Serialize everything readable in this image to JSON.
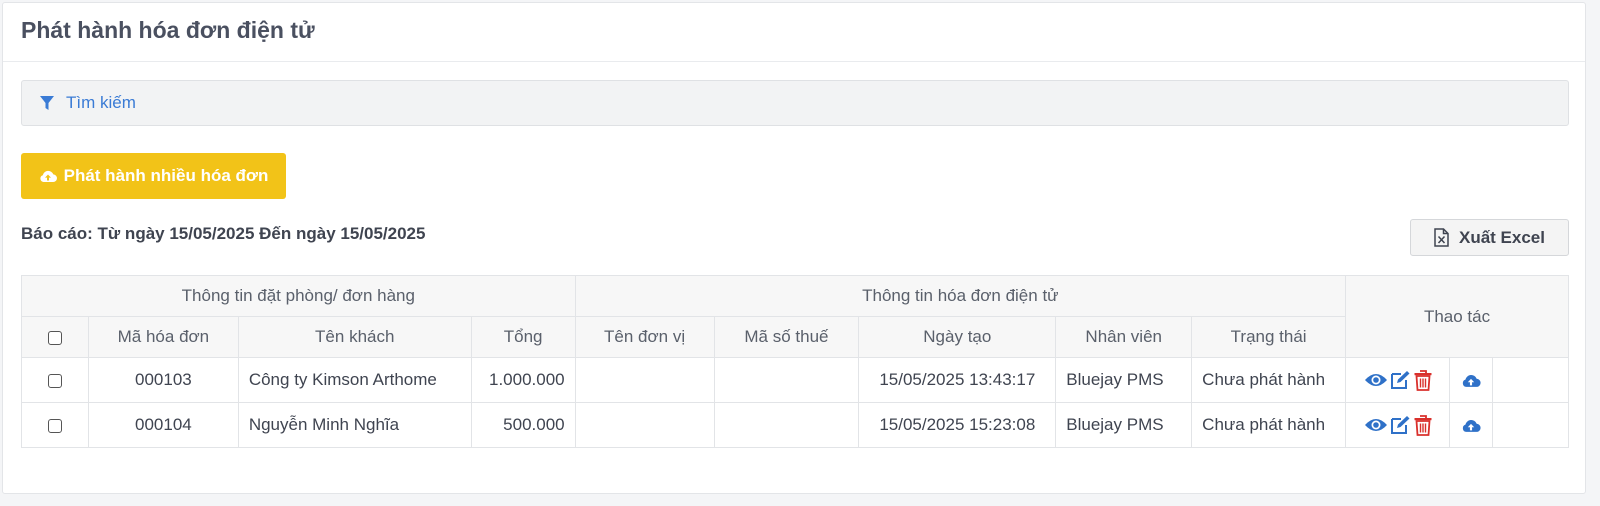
{
  "page": {
    "title": "Phát hành hóa đơn điện tử"
  },
  "search": {
    "label": "Tìm kiếm"
  },
  "actions": {
    "publish_many": "Phát hành nhiều hóa đơn",
    "export_excel": "Xuất Excel"
  },
  "report": {
    "range": "Báo cáo: Từ ngày 15/05/2025 Đến ngày 15/05/2025"
  },
  "table": {
    "group_headers": {
      "booking": "Thông tin đặt phòng/ đơn hàng",
      "einvoice": "Thông tin hóa đơn điện tử",
      "actions": "Thao tác"
    },
    "columns": {
      "invoice_code": "Mã hóa đơn",
      "customer": "Tên khách",
      "total": "Tổng",
      "unit_name": "Tên đơn vị",
      "tax_code": "Mã số thuế",
      "created": "Ngày tạo",
      "staff": "Nhân viên",
      "status": "Trạng thái"
    },
    "rows": [
      {
        "invoice_code": "000103",
        "customer": "Công ty Kimson Arthome",
        "total": "1.000.000",
        "unit_name": "",
        "tax_code": "",
        "created": "15/05/2025 13:43:17",
        "staff": "Bluejay PMS",
        "status": "Chưa phát hành"
      },
      {
        "invoice_code": "000104",
        "customer": "Nguyễn Minh Nghĩa",
        "total": "500.000",
        "unit_name": "",
        "tax_code": "",
        "created": "15/05/2025 15:23:08",
        "staff": "Bluejay PMS",
        "status": "Chưa phát hành"
      }
    ]
  },
  "colors": {
    "accent_blue": "#3a7bd5",
    "warning_yellow": "#f2c318",
    "danger_red": "#d9302c"
  },
  "icons": {
    "search": "filter-icon",
    "publish": "cloud-upload-icon",
    "excel": "excel-file-icon",
    "view": "eye-icon",
    "edit": "edit-icon",
    "delete": "trash-icon",
    "upload": "cloud-upload-icon"
  }
}
